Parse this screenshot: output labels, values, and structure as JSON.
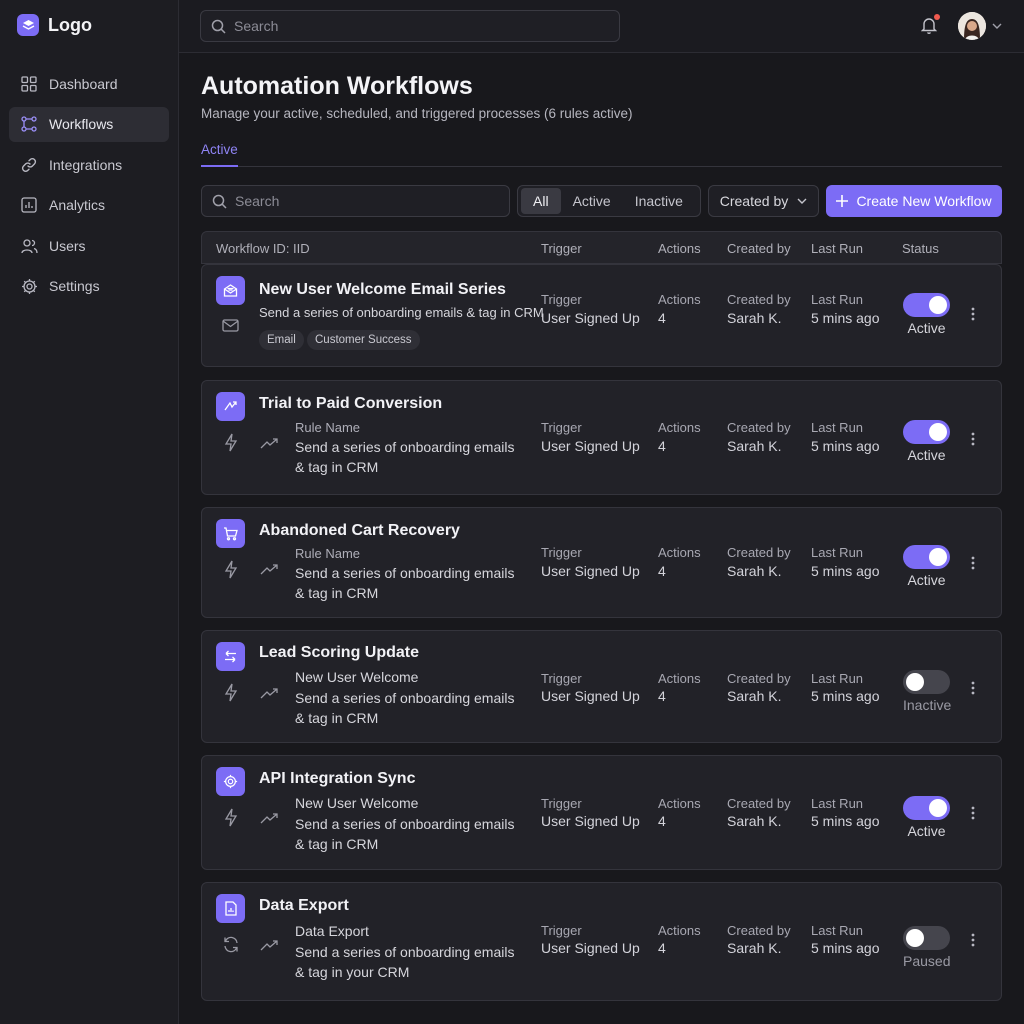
{
  "app": {
    "logo_text": "Logo"
  },
  "colors": {
    "accent": "#7c6cf5",
    "bg": "#18181c",
    "card": "#222228"
  },
  "sidebar": {
    "items": [
      {
        "label": "Dashboard",
        "icon": "grid-icon",
        "active": false
      },
      {
        "label": "Workflows",
        "icon": "workflow-icon",
        "active": true
      },
      {
        "label": "Integrations",
        "icon": "link-icon",
        "active": false
      },
      {
        "label": "Analytics",
        "icon": "chart-icon",
        "active": false
      },
      {
        "label": "Users",
        "icon": "users-icon",
        "active": false
      },
      {
        "label": "Settings",
        "icon": "gear-icon",
        "active": false
      }
    ]
  },
  "topbar": {
    "search_placeholder": "Search"
  },
  "page": {
    "title": "Automation Workflows",
    "subtitle": "Manage your active, scheduled, and triggered processes (6 rules active)",
    "tab": "Active"
  },
  "toolbar": {
    "search_placeholder": "Search",
    "filters": [
      "All",
      "Active",
      "Inactive"
    ],
    "selected_filter": "All",
    "created_by_label": "Created by",
    "create_label": "Create New Workflow"
  },
  "table": {
    "headers": {
      "workflow": "Workflow ID: IID",
      "trigger": "Trigger",
      "actions": "Actions",
      "created_by": "Created by",
      "last_run": "Last Run",
      "status": "Status"
    },
    "col_labels": {
      "trigger": "Trigger",
      "actions": "Actions",
      "created_by": "Created by",
      "last_run": "Last Run"
    },
    "rows": [
      {
        "name": "New User Welcome Email Series",
        "icon": "mail-open-icon",
        "description": "Send a series of onboarding emails & tag in CRM",
        "sub_label": "",
        "tags": [
          "Email",
          "Customer Success"
        ],
        "trigger": "User Signed Up",
        "actions": "4",
        "created_by": "Sarah K.",
        "last_run": "5 mins ago",
        "status": "Active",
        "enabled": true
      },
      {
        "name": "Trial to Paid Conversion",
        "icon": "convert-icon",
        "sub_label": "Rule Name",
        "description": "Send a series of onboarding emails & tag in CRM",
        "trigger": "User Signed Up",
        "actions": "4",
        "created_by": "Sarah K.",
        "last_run": "5 mins ago",
        "status": "Active",
        "enabled": true
      },
      {
        "name": "Abandoned Cart Recovery",
        "icon": "cart-icon",
        "sub_label": "Rule Name",
        "description": "Send a series of onboarding emails & tag in CRM",
        "trigger": "User Signed Up",
        "actions": "4",
        "created_by": "Sarah K.",
        "last_run": "5 mins ago",
        "status": "Active",
        "enabled": true
      },
      {
        "name": "Lead Scoring Update",
        "icon": "swap-icon",
        "sub_label": "New User Welcome",
        "description": "Send a series of onboarding emails & tag in CRM",
        "trigger": "User Signed Up",
        "actions": "4",
        "created_by": "Sarah K.",
        "last_run": "5 mins ago",
        "status": "Inactive",
        "enabled": false
      },
      {
        "name": "API Integration Sync",
        "icon": "gear-icon",
        "sub_label": "New User Welcome",
        "description": "Send a series of onboarding emails & tag in CRM",
        "trigger": "User Signed Up",
        "actions": "4",
        "created_by": "Sarah K.",
        "last_run": "5 mins ago",
        "status": "Active",
        "enabled": true
      },
      {
        "name": "Data Export",
        "icon": "file-chart-icon",
        "sub_label": "Data Export",
        "description": "Send a series of onboarding emails & tag in your CRM",
        "trigger": "User Signed Up",
        "actions": "4",
        "created_by": "Sarah K.",
        "last_run": "5 mins ago",
        "status": "Paused",
        "enabled": false
      }
    ]
  }
}
